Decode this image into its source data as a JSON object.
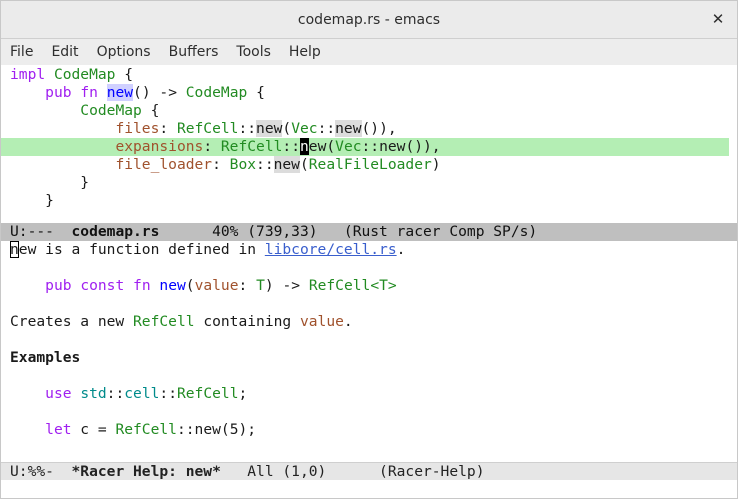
{
  "window": {
    "title": "codemap.rs - emacs",
    "close_glyph": "✕"
  },
  "menu": [
    "File",
    "Edit",
    "Options",
    "Buffers",
    "Tools",
    "Help"
  ],
  "top_pane": {
    "l1": {
      "impl": "impl",
      "codemap": "CodeMap",
      "brace": " {"
    },
    "l2": {
      "indent": "    ",
      "pub": "pub",
      "fn": "fn",
      "new": "new",
      "sig": "() -> ",
      "ret": "CodeMap",
      "brace": " {"
    },
    "l3": {
      "indent": "        ",
      "codemap": "CodeMap",
      "brace": " {"
    },
    "l4": {
      "indent": "            ",
      "field": "files",
      "colon": ": ",
      "ty": "RefCell",
      "sep": "::",
      "new": "new",
      "open": "(",
      "vec": "Vec",
      "sep2": "::",
      "vnew": "new",
      "close": "()),"
    },
    "l5": {
      "indent": "            ",
      "field": "expansions",
      "colon": ": ",
      "ty": "RefCell",
      "sep": "::",
      "cur": "n",
      "rest": "ew",
      "open": "(",
      "vec": "Vec",
      "sep2": "::",
      "vnew": "new",
      "close": "()),"
    },
    "l6": {
      "indent": "            ",
      "field": "file_loader",
      "colon": ": ",
      "ty": "Box",
      "sep": "::",
      "new": "new",
      "open": "(",
      "arg": "RealFileLoader",
      "close": ")"
    },
    "l7": {
      "indent": "        ",
      "text": "}"
    },
    "l8": {
      "indent": "    ",
      "text": "}"
    }
  },
  "modeline_top": {
    "state": "U:---  ",
    "buffer": "codemap.rs",
    "position": "      40% (739,33)   ",
    "modes": "(Rust racer Comp SP/s)"
  },
  "help_pane": {
    "l1": {
      "cur": "n",
      "pre": "ew is a function defined in ",
      "link": "libcore/cell.rs",
      "post": "."
    },
    "l3": {
      "indent": "    ",
      "pub": "pub",
      "const": "const",
      "fn": "fn",
      "new": "new",
      "open": "(",
      "value": "value",
      "colon": ": ",
      "t": "T",
      "mid": ") -> ",
      "refcell": "RefCell",
      "gen": "<T>"
    },
    "l5": {
      "pre": "Creates a new ",
      "refcell": "RefCell",
      "mid": " containing ",
      "value": "value",
      "post": "."
    },
    "l7": {
      "text": "Examples"
    },
    "l9": {
      "indent": "    ",
      "use": "use",
      "std": "std",
      "sep": "::",
      "cell": "cell",
      "sep2": "::",
      "refcell": "RefCell",
      "post": ";"
    },
    "l11": {
      "indent": "    ",
      "let": "let",
      "mid": " c = ",
      "refcell": "RefCell",
      "sep": "::",
      "new": "new",
      "post": "(5);"
    }
  },
  "modeline_bottom": {
    "state": "U:%%-  ",
    "buffer": "*Racer Help: new*",
    "position": "   All (1,0)      ",
    "modes": "(Racer-Help)"
  }
}
